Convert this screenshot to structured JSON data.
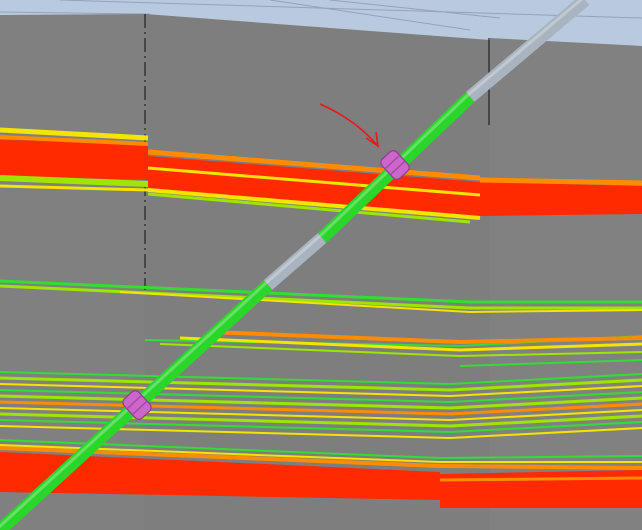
{
  "viewer": {
    "background_color": "#b9c9de",
    "section_color": "#808080",
    "grid_line_color": "#7a8596"
  },
  "well": {
    "segment_colors": {
      "green": "#2bd62b",
      "gray": "#a8b4bf"
    },
    "packer_color": "#cc66cc",
    "arrow_color": "#e81818"
  },
  "horizon_colors": {
    "red": "#ff2a00",
    "orange": "#ff8c00",
    "yellow": "#f5e400",
    "lime": "#9ee600",
    "green": "#33dd33"
  }
}
